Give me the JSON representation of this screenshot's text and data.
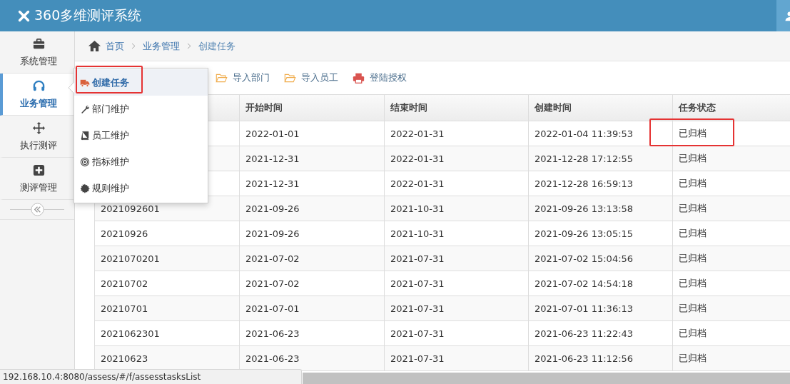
{
  "app": {
    "title": "360多维测评系统"
  },
  "sidebar": {
    "items": [
      {
        "label": "系统管理",
        "selected": false
      },
      {
        "label": "业务管理",
        "selected": true
      },
      {
        "label": "执行测评",
        "selected": false
      },
      {
        "label": "测评管理",
        "selected": false
      }
    ]
  },
  "breadcrumb": [
    {
      "label": "首页",
      "current": false
    },
    {
      "label": "业务管理",
      "current": false
    },
    {
      "label": "创建任务",
      "current": true
    }
  ],
  "toolbar": {
    "buttons": [
      {
        "label": "导入部门"
      },
      {
        "label": "导入员工"
      },
      {
        "label": "登陆授权"
      }
    ]
  },
  "dropdown_menu": {
    "items": [
      {
        "label": "创建任务",
        "selected": true,
        "annotated": true
      },
      {
        "label": "部门维护",
        "selected": false,
        "annotated": false
      },
      {
        "label": "员工维护",
        "selected": false,
        "annotated": false
      },
      {
        "label": "指标维护",
        "selected": false,
        "annotated": false
      },
      {
        "label": "规则维护",
        "selected": false,
        "annotated": false
      }
    ]
  },
  "table": {
    "columns": [
      "开始时间",
      "结束时间",
      "创建时间",
      "任务状态"
    ],
    "rows": [
      {
        "start": "2022-01-01",
        "end": "2022-01-31",
        "created": "2022-01-04 11:39:53",
        "status": "已归档",
        "status_annotated": true
      },
      {
        "start": "2021-12-31",
        "end": "2022-01-31",
        "created": "2021-12-28 17:12:55",
        "status": "已归档",
        "status_annotated": false
      },
      {
        "start": "2021-12-31",
        "end": "2022-01-31",
        "created": "2021-12-28 16:59:13",
        "status": "已归档",
        "status_annotated": false
      },
      {
        "column_1": "2021092601",
        "start": "2021-09-26",
        "end": "2021-10-31",
        "created": "2021-09-26 13:13:58",
        "status": "已归档",
        "status_annotated": false
      },
      {
        "column_1": "20210926",
        "start": "2021-09-26",
        "end": "2021-10-31",
        "created": "2021-09-26 13:05:15",
        "status": "已归档",
        "status_annotated": false
      },
      {
        "column_1": "2021070201",
        "start": "2021-07-02",
        "end": "2021-07-31",
        "created": "2021-07-02 15:04:56",
        "status": "已归档",
        "status_annotated": false
      },
      {
        "column_1": "20210702",
        "start": "2021-07-02",
        "end": "2021-07-31",
        "created": "2021-07-02 14:54:18",
        "status": "已归档",
        "status_annotated": false
      },
      {
        "column_1": "20210701",
        "start": "2021-07-01",
        "end": "2021-07-31",
        "created": "2021-07-01 11:36:13",
        "status": "已归档",
        "status_annotated": false
      },
      {
        "column_1": "2021062301",
        "start": "2021-06-23",
        "end": "2021-07-31",
        "created": "2021-06-23 11:22:43",
        "status": "已归档",
        "status_annotated": false
      },
      {
        "column_1": "20210623",
        "start": "2021-06-23",
        "end": "2021-07-31",
        "created": "2021-06-23 11:12:56",
        "status": "已归档",
        "status_annotated": false
      }
    ]
  },
  "status_bar": {
    "url": "192.168.10.4:8080/assess/#/f/assesstasksList"
  }
}
